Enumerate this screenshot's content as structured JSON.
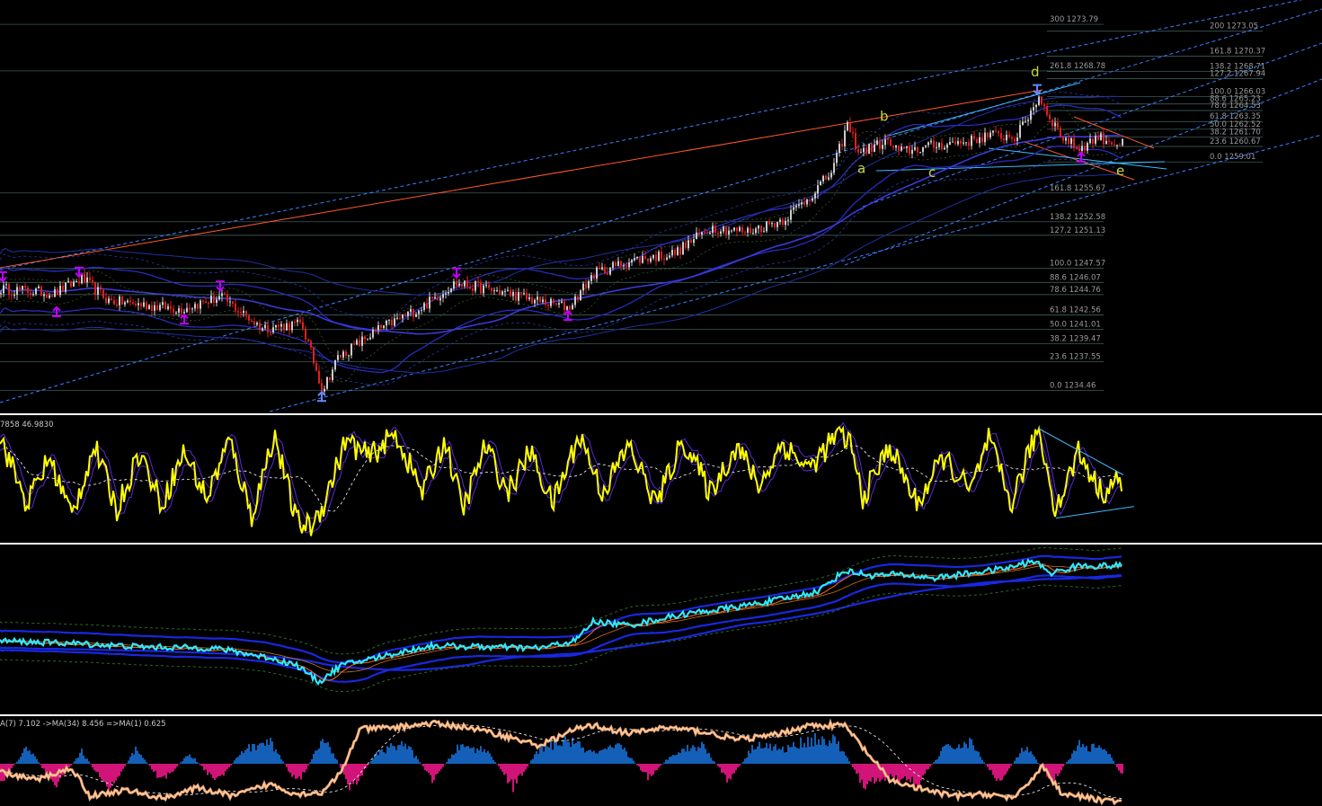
{
  "chart_data": [
    {
      "type": "line",
      "panel": "main",
      "ylim": [
        1232.2,
        1276.4
      ],
      "x_count": 1250,
      "price_path": {
        "x": [
          0,
          60,
          90,
          120,
          200,
          245,
          290,
          335,
          358,
          375,
          420,
          470,
          505,
          560,
          600,
          632,
          660,
          700,
          750,
          790,
          830,
          870,
          900,
          925,
          942,
          955,
          985,
          1000,
          1040,
          1080,
          1100,
          1130,
          1155,
          1165,
          1180,
          1200,
          1220,
          1245
        ],
        "y": [
          1245.4,
          1244.9,
          1246.5,
          1244.1,
          1243.2,
          1244.5,
          1241.2,
          1241.6,
          1234.5,
          1238.0,
          1241.0,
          1243.5,
          1246.0,
          1245.0,
          1244.0,
          1243.4,
          1247.0,
          1248.4,
          1249.2,
          1252.0,
          1251.5,
          1252.8,
          1255.3,
          1258.0,
          1263.0,
          1260.0,
          1261.2,
          1260.1,
          1260.8,
          1261.3,
          1261.9,
          1261.7,
          1266.0,
          1264.2,
          1261.8,
          1260.4,
          1261.7,
          1260.9
        ]
      },
      "fib_levels_left": [
        {
          "label": "300 1273.79",
          "value": 1273.79
        },
        {
          "label": "261.8 1268.78",
          "value": 1268.78
        },
        {
          "label": "161.8 1255.67",
          "value": 1255.67
        },
        {
          "label": "138.2 1252.58",
          "value": 1252.58
        },
        {
          "label": "127.2 1251.13",
          "value": 1251.13
        },
        {
          "label": "100.0 1247.57",
          "value": 1247.57
        },
        {
          "label": "88.6 1246.07",
          "value": 1246.07
        },
        {
          "label": "78.6 1244.76",
          "value": 1244.76
        },
        {
          "label": "61.8 1242.56",
          "value": 1242.56
        },
        {
          "label": "50.0 1241.01",
          "value": 1241.01
        },
        {
          "label": "38.2 1239.47",
          "value": 1239.47
        },
        {
          "label": "23.6 1237.55",
          "value": 1237.55
        },
        {
          "label": "0.0 1234.46",
          "value": 1234.46
        }
      ],
      "fib_levels_right": [
        {
          "label": "200 1273.05",
          "value": 1273.05
        },
        {
          "label": "161.8 1270.37",
          "value": 1270.37
        },
        {
          "label": "138.2 1268.71",
          "value": 1268.71
        },
        {
          "label": "127.2 1267.94",
          "value": 1267.94
        },
        {
          "label": "100.0 1266.03",
          "value": 1266.03
        },
        {
          "label": "88.6 1265.23",
          "value": 1265.23
        },
        {
          "label": "78.6 1264.53",
          "value": 1264.53
        },
        {
          "label": "61.8 1263.35",
          "value": 1263.35
        },
        {
          "label": "50.0 1262.52",
          "value": 1262.52
        },
        {
          "label": "38.2 1261.70",
          "value": 1261.7
        },
        {
          "label": "23.6 1260.67",
          "value": 1260.67
        },
        {
          "label": "0.0 1259.01",
          "value": 1259.01
        }
      ],
      "wave_labels": [
        {
          "label": "a",
          "x": 958,
          "value": 1257.8,
          "color": "#c8d83a"
        },
        {
          "label": "b",
          "x": 983,
          "value": 1263.4,
          "color": "#c8d83a"
        },
        {
          "label": "c",
          "x": 1037,
          "value": 1257.4,
          "color": "#c8d83a"
        },
        {
          "label": "d",
          "x": 1151,
          "value": 1268.2,
          "color": "#c8d83a"
        },
        {
          "label": "e",
          "x": 1246,
          "value": 1257.6,
          "color": "#c8d83a"
        }
      ],
      "fractal_markers": [
        {
          "x": 3,
          "value": 1246.2,
          "dir": "down",
          "color": "#c000ff"
        },
        {
          "x": 63,
          "value": 1243.4,
          "dir": "up",
          "color": "#c000ff"
        },
        {
          "x": 88,
          "value": 1246.7,
          "dir": "down",
          "color": "#c000ff"
        },
        {
          "x": 205,
          "value": 1242.6,
          "dir": "up",
          "color": "#c000ff"
        },
        {
          "x": 245,
          "value": 1245.2,
          "dir": "down",
          "color": "#c000ff"
        },
        {
          "x": 358,
          "value": 1234.3,
          "dir": "up",
          "color": "#6688ff"
        },
        {
          "x": 508,
          "value": 1246.6,
          "dir": "down",
          "color": "#c000ff"
        },
        {
          "x": 632,
          "value": 1243.0,
          "dir": "up",
          "color": "#c000ff"
        },
        {
          "x": 1154,
          "value": 1266.3,
          "dir": "down",
          "color": "#6688ff"
        },
        {
          "x": 1203,
          "value": 1260.0,
          "dir": "up",
          "color": "#c000ff"
        }
      ],
      "colors": {
        "bull": "#cccccc",
        "bear": "#e02020",
        "channel": "#3a7fff",
        "trend_red": "#ff5a28",
        "trend_cyan": "#40b8ff",
        "band": "#2838c8"
      }
    },
    {
      "type": "line",
      "panel": "oscillator",
      "header": "7858 46.9830",
      "ylim": [
        0,
        100
      ],
      "series": [
        {
          "color": "#ffff00"
        },
        {
          "color": "#5a2ad8"
        },
        {
          "color": "#ffffff"
        }
      ],
      "x": [
        0,
        30,
        55,
        80,
        105,
        130,
        155,
        180,
        205,
        230,
        255,
        280,
        305,
        330,
        345,
        360,
        385,
        410,
        440,
        470,
        495,
        515,
        540,
        565,
        590,
        615,
        645,
        670,
        700,
        730,
        760,
        790,
        820,
        845,
        870,
        900,
        930,
        945,
        960,
        990,
        1020,
        1050,
        1080,
        1100,
        1125,
        1155,
        1175,
        1200,
        1225,
        1245
      ],
      "values": [
        88,
        30,
        70,
        20,
        80,
        25,
        75,
        30,
        75,
        35,
        85,
        20,
        90,
        15,
        10,
        30,
        85,
        70,
        90,
        40,
        85,
        25,
        80,
        40,
        75,
        30,
        90,
        40,
        80,
        30,
        85,
        40,
        80,
        45,
        82,
        60,
        88,
        85,
        35,
        80,
        30,
        70,
        40,
        85,
        30,
        95,
        25,
        75,
        40,
        50
      ],
      "trendlines": [
        {
          "x": [
            1155,
            1250
          ],
          "values": [
            95,
            55
          ]
        },
        {
          "x": [
            1175,
            1262
          ],
          "values": [
            18,
            28
          ]
        }
      ]
    },
    {
      "type": "line",
      "panel": "band_indicator",
      "ylim": [
        0,
        100
      ],
      "x": [
        0,
        80,
        160,
        240,
        300,
        330,
        355,
        380,
        430,
        480,
        540,
        600,
        640,
        660,
        700,
        760,
        820,
        880,
        910,
        940,
        970,
        1000,
        1040,
        1080,
        1120,
        1150,
        1170,
        1200,
        1250
      ],
      "values": [
        42,
        40,
        37,
        36,
        28,
        22,
        8,
        22,
        30,
        38,
        37,
        36,
        42,
        58,
        55,
        64,
        70,
        78,
        83,
        100,
        96,
        97,
        94,
        98,
        102,
        108,
        98,
        104,
        104
      ],
      "colors": {
        "main": "#30e8ff",
        "bands": "#1828e0",
        "outer": "#2a6a2a",
        "mid": "#ff6a1a"
      }
    },
    {
      "type": "area",
      "panel": "histogram",
      "header": "A(7) 7.102  ->MA(34) 8.456  =>MA(1) 0.625",
      "ylim": [
        -100,
        100
      ],
      "x": [
        0,
        30,
        60,
        90,
        120,
        150,
        180,
        210,
        240,
        270,
        300,
        330,
        360,
        390,
        420,
        450,
        480,
        510,
        540,
        570,
        600,
        630,
        660,
        690,
        720,
        750,
        780,
        810,
        840,
        870,
        900,
        930,
        960,
        990,
        1020,
        1050,
        1080,
        1110,
        1140,
        1170,
        1200,
        1230,
        1250
      ],
      "values": [
        -55,
        50,
        -65,
        35,
        -75,
        40,
        -50,
        30,
        -55,
        40,
        65,
        -60,
        80,
        -70,
        35,
        60,
        -45,
        50,
        40,
        -65,
        45,
        70,
        30,
        50,
        -40,
        35,
        55,
        -50,
        60,
        40,
        70,
        65,
        -60,
        -40,
        -55,
        45,
        60,
        -55,
        50,
        -50,
        55,
        40,
        -40
      ],
      "overlay_line": {
        "x": [
          0,
          40,
          80,
          100,
          140,
          180,
          220,
          260,
          300,
          330,
          360,
          380,
          400,
          440,
          480,
          520,
          560,
          600,
          640,
          660,
          700,
          740,
          780,
          820,
          860,
          900,
          940,
          960,
          990,
          1020,
          1060,
          1100,
          1130,
          1160,
          1180,
          1210,
          1250
        ],
        "values": [
          -20,
          -40,
          -10,
          -80,
          -65,
          -85,
          -60,
          -80,
          -50,
          -75,
          -70,
          -20,
          85,
          90,
          100,
          90,
          70,
          45,
          85,
          95,
          75,
          90,
          80,
          60,
          70,
          95,
          95,
          40,
          -40,
          -60,
          -80,
          -75,
          -85,
          -5,
          -70,
          -85,
          -95
        ]
      },
      "colors": {
        "positive": "#1460b8",
        "negative": "#d01478",
        "line": "#ffd0a0"
      }
    }
  ]
}
